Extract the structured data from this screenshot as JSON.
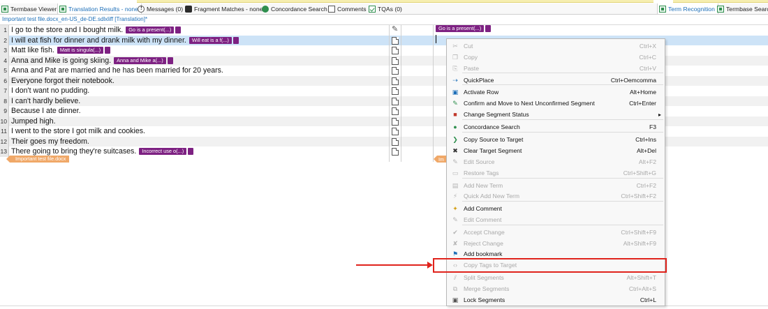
{
  "tabs_left": [
    {
      "label": "Termbase Viewer",
      "icon": "termbase-icon"
    },
    {
      "label": "Translation Results - none",
      "icon": "translation-results-icon",
      "active": true
    },
    {
      "label": "Messages (0)",
      "icon": "messages-icon"
    },
    {
      "label": "Fragment Matches - none",
      "icon": "fragment-matches-icon"
    },
    {
      "label": "Concordance Search",
      "icon": "concordance-icon"
    },
    {
      "label": "Comments",
      "icon": "comments-icon"
    },
    {
      "label": "TQAs (0)",
      "icon": "tqa-icon"
    }
  ],
  "tabs_right": [
    {
      "label": "Term Recognition",
      "icon": "term-recognition-icon",
      "active": true
    },
    {
      "label": "Termbase Search",
      "icon": "termbase-search-icon"
    }
  ],
  "document_tab": "Important test file.docx_en-US_de-DE.sdlxliff [Translation]*",
  "segments": [
    {
      "num": "1",
      "text": "I go to the store and I bought milk.",
      "tag": "Go is a present(...)"
    },
    {
      "num": "2",
      "text": "I will eat fish for dinner and drank milk with my dinner.",
      "tag": "Will eat is a f(...)"
    },
    {
      "num": "3",
      "text": "Matt like fish.",
      "tag": "Matt is singula(...)"
    },
    {
      "num": "4",
      "text": "Anna and Mike is going skiing.",
      "tag": "Anna and Mike a(...)"
    },
    {
      "num": "5",
      "text": "Anna and Pat are married and he has been married for 20 years.",
      "tag": ""
    },
    {
      "num": "6",
      "text": "Everyone forgot their notebook.",
      "tag": ""
    },
    {
      "num": "7",
      "text": "I don't want no pudding.",
      "tag": ""
    },
    {
      "num": "8",
      "text": "I can't hardly believe.",
      "tag": ""
    },
    {
      "num": "9",
      "text": "Because I ate dinner.",
      "tag": ""
    },
    {
      "num": "10",
      "text": "Jumped high.",
      "tag": ""
    },
    {
      "num": "11",
      "text": "I went to the store I got milk and cookies.",
      "tag": ""
    },
    {
      "num": "12",
      "text": "Their goes my freedom.",
      "tag": ""
    },
    {
      "num": "13",
      "text": "There going to bring they're suitcases.",
      "tag": "Incorrect use o(...)"
    }
  ],
  "target_tag": "Go is a present(...)",
  "file_tag": "Important test file.docx",
  "file_tag_right": "Im",
  "context_menu": [
    {
      "label": "Cut",
      "key": "Ctrl+X",
      "disabled": true,
      "icon": "cut-icon"
    },
    {
      "label": "Copy",
      "key": "Ctrl+C",
      "disabled": true,
      "icon": "copy-icon"
    },
    {
      "label": "Paste",
      "key": "Ctrl+V",
      "disabled": true,
      "icon": "paste-icon"
    },
    {
      "label": "QuickPlace",
      "key": "Ctrl+Oemcomma",
      "disabled": false,
      "icon": "quickplace-icon"
    },
    {
      "label": "Activate Row",
      "key": "Alt+Home",
      "disabled": false,
      "icon": "activate-row-icon"
    },
    {
      "label": "Confirm and Move to Next Unconfirmed Segment",
      "key": "Ctrl+Enter",
      "disabled": false,
      "icon": "confirm-icon"
    },
    {
      "label": "Change Segment Status",
      "key": "",
      "disabled": false,
      "submenu": true,
      "icon": "segment-status-icon"
    },
    {
      "label": "Concordance Search",
      "key": "F3",
      "disabled": false,
      "icon": "concordance-search-icon"
    },
    {
      "label": "Copy Source to Target",
      "key": "Ctrl+Ins",
      "disabled": false,
      "icon": "copy-source-icon"
    },
    {
      "label": "Clear Target Segment",
      "key": "Alt+Del",
      "disabled": false,
      "icon": "clear-target-icon"
    },
    {
      "label": "Edit Source",
      "key": "Alt+F2",
      "disabled": true,
      "icon": "edit-source-icon"
    },
    {
      "label": "Restore Tags",
      "key": "Ctrl+Shift+G",
      "disabled": true,
      "icon": "restore-tags-icon"
    },
    {
      "label": "Add New Term",
      "key": "Ctrl+F2",
      "disabled": true,
      "icon": "add-term-icon"
    },
    {
      "label": "Quick Add New Term",
      "key": "Ctrl+Shift+F2",
      "disabled": true,
      "icon": "quick-add-term-icon"
    },
    {
      "label": "Add Comment",
      "key": "",
      "disabled": false,
      "icon": "add-comment-icon"
    },
    {
      "label": "Edit Comment",
      "key": "",
      "disabled": true,
      "icon": "edit-comment-icon"
    },
    {
      "label": "Accept Change",
      "key": "Ctrl+Shift+F9",
      "disabled": true,
      "icon": "accept-change-icon"
    },
    {
      "label": "Reject Change",
      "key": "Alt+Shift+F9",
      "disabled": true,
      "icon": "reject-change-icon"
    },
    {
      "label": "Add bookmark",
      "key": "",
      "disabled": false,
      "icon": "bookmark-icon"
    },
    {
      "label": "Copy Tags to Target",
      "key": "",
      "disabled": true,
      "icon": "copy-tags-icon"
    },
    {
      "label": "Split Segments",
      "key": "Alt+Shift+T",
      "disabled": true,
      "icon": "split-segments-icon"
    },
    {
      "label": "Merge Segments",
      "key": "Ctrl+Alt+S",
      "disabled": true,
      "icon": "merge-segments-icon"
    },
    {
      "label": "Lock Segments",
      "key": "Ctrl+L",
      "disabled": false,
      "icon": "lock-icon"
    }
  ],
  "colors": {
    "tag_purple": "#7d2182",
    "file_tag_orange": "#f0a868",
    "selected_row": "#cde3f7",
    "annotation_red": "#e0231c",
    "link_blue": "#1d6fb8"
  }
}
